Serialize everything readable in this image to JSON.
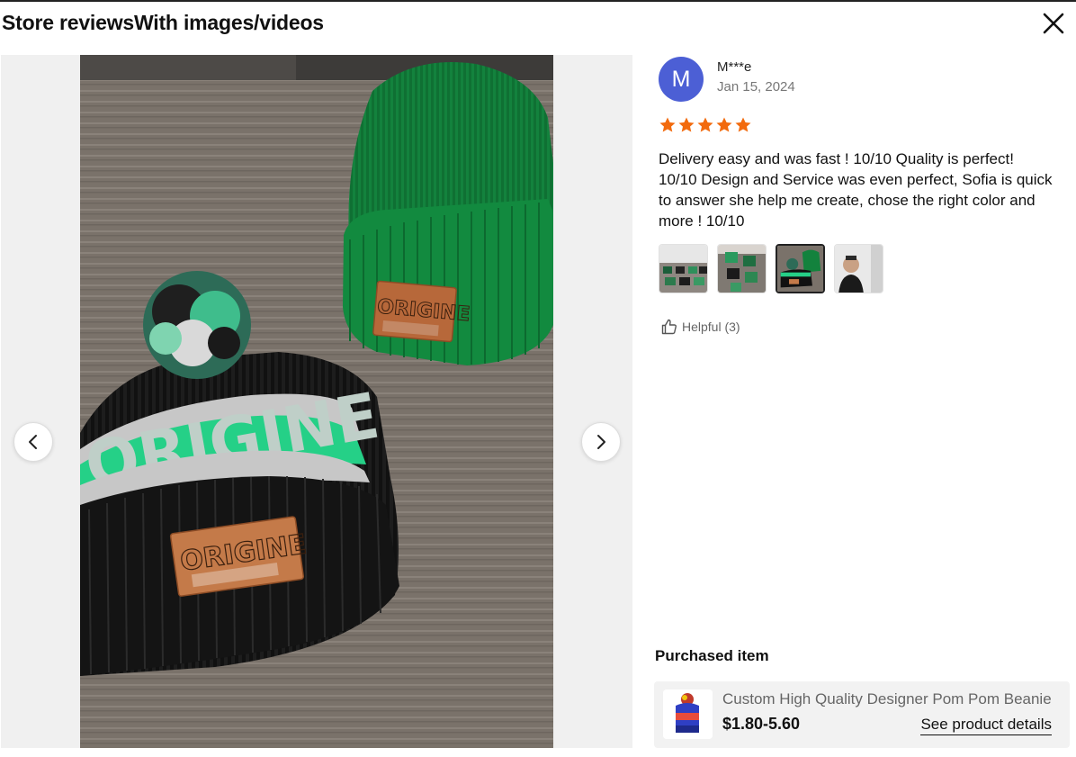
{
  "header": {
    "title": "Store reviewsWith images/videos",
    "close_icon": "close-icon"
  },
  "gallery": {
    "prev_icon": "chevron-left-icon",
    "next_icon": "chevron-right-icon",
    "main_image": "Photo of a black and green pom pom beanie and a green cuffed beanie with ORIGINE leather patches on a wooden table",
    "beanie_front_text": "ORIGINE",
    "beanie_back_text": "ORIGINE",
    "knit_text": "ORIGINE"
  },
  "review": {
    "avatar_letter": "M",
    "reviewer": "M***e",
    "date": "Jan 15, 2024",
    "rating": 5,
    "text": "Delivery easy and was fast ! 10/10 Quality is perfect! 10/10 Design and Service was even perfect, Sofia is quick to answer she help me create, chose the right color and more ! 10/10",
    "thumbnails": [
      "thumb-1",
      "thumb-2",
      "thumb-3",
      "thumb-4"
    ],
    "active_thumbnail": 2,
    "helpful_label": "Helpful (3)",
    "helpful_icon": "thumbs-up-icon"
  },
  "purchased": {
    "title": "Purchased item",
    "product_name": "Custom High Quality Designer Pom Pom Beanie",
    "price": "$1.80-5.60",
    "details_link": "See product details"
  },
  "colors": {
    "star": "#f26a0d",
    "avatar": "#4c5fd5"
  }
}
